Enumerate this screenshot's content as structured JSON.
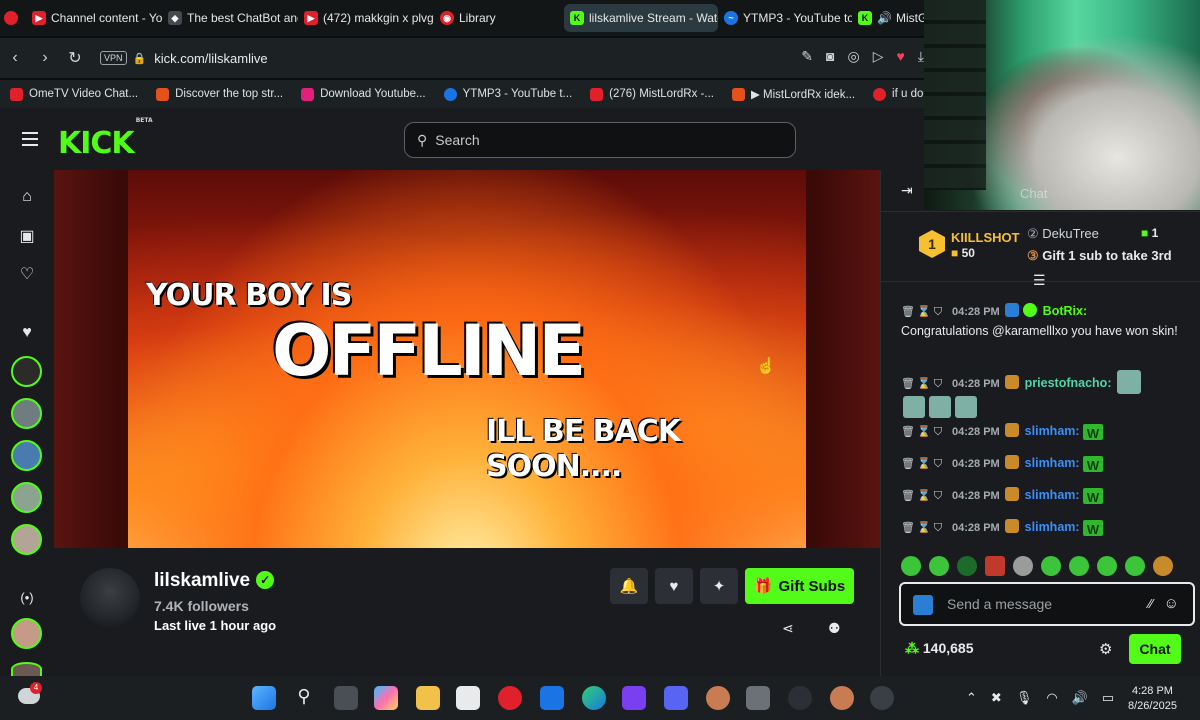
{
  "browser": {
    "tabs": [
      {
        "label": "Channel content - You",
        "color": "#e0202a"
      },
      {
        "label": "The best ChatBot and",
        "color": "#2a2e33"
      },
      {
        "label": "(472) makkgin x plvg",
        "color": "#e0202a"
      },
      {
        "label": "Library",
        "color": "#e0202a"
      },
      {
        "label": "lilskamlive Stream - Watc",
        "color": "#53fc18",
        "active": true
      },
      {
        "label": "YTMP3 - YouTube to",
        "color": "#1b74e4"
      },
      {
        "label": "MistGodRx Strea",
        "color": "#53fc18"
      }
    ],
    "address": {
      "vpn": "VPN",
      "url": "kick.com/lilskamlive"
    },
    "bookmarks": [
      {
        "label": "OmeTV Video Chat...",
        "color": "#e0202a"
      },
      {
        "label": "Discover the top str...",
        "color": "#e3521c"
      },
      {
        "label": "Download Youtube...",
        "color": "#e0207a"
      },
      {
        "label": "YTMP3 - YouTube t...",
        "color": "#1b74e4"
      },
      {
        "label": "(276) MistLordRx -...",
        "color": "#e0202a"
      },
      {
        "label": "▶ MistLordRx idek...",
        "color": "#e3521c"
      },
      {
        "label": "if u dont likeit you b...",
        "color": "#e0202a"
      }
    ]
  },
  "kick": {
    "logo": "KICK",
    "logo_beta": "BETA",
    "search_placeholder": "Search",
    "offline": {
      "line1": "YOUR BOY IS",
      "line2": "OFFLINE",
      "line3": "ILL BE BACK SOON...."
    },
    "channel": {
      "name": "lilskamlive",
      "followers": "7.4K followers",
      "last_live": "Last live 1 hour ago",
      "gift_label": "Gift Subs"
    },
    "chat": {
      "leaderboard": {
        "first_rank": "1",
        "first_name": "KIILLSHOT",
        "first_value": "50",
        "second_name": "DekuTree",
        "second_value": "1",
        "third_label": "Gift 1 sub to take 3rd"
      },
      "messages": [
        {
          "time": "04:28 PM",
          "user": "BotRix:",
          "user_color": "#53fc18",
          "text": "Congratulations @karamelllxo you have won skin!"
        },
        {
          "time": "04:28 PM",
          "user": "priestofnacho:",
          "user_color": "#56d3a4",
          "text": ""
        },
        {
          "time": "04:28 PM",
          "user": "slimham:",
          "user_color": "#3a8ef6",
          "text": "W"
        },
        {
          "time": "04:28 PM",
          "user": "slimham:",
          "user_color": "#3a8ef6",
          "text": "W"
        },
        {
          "time": "04:28 PM",
          "user": "slimham:",
          "user_color": "#3a8ef6",
          "text": "W"
        },
        {
          "time": "04:28 PM",
          "user": "slimham:",
          "user_color": "#3a8ef6",
          "text": "W"
        }
      ],
      "input_placeholder": "Send a message",
      "points": "140,685",
      "chat_button": "Chat"
    }
  },
  "webcam": {
    "overlay_text": "Chat"
  },
  "taskbar": {
    "time": "4:28 PM",
    "date": "8/26/2025",
    "notification_count": "4"
  }
}
